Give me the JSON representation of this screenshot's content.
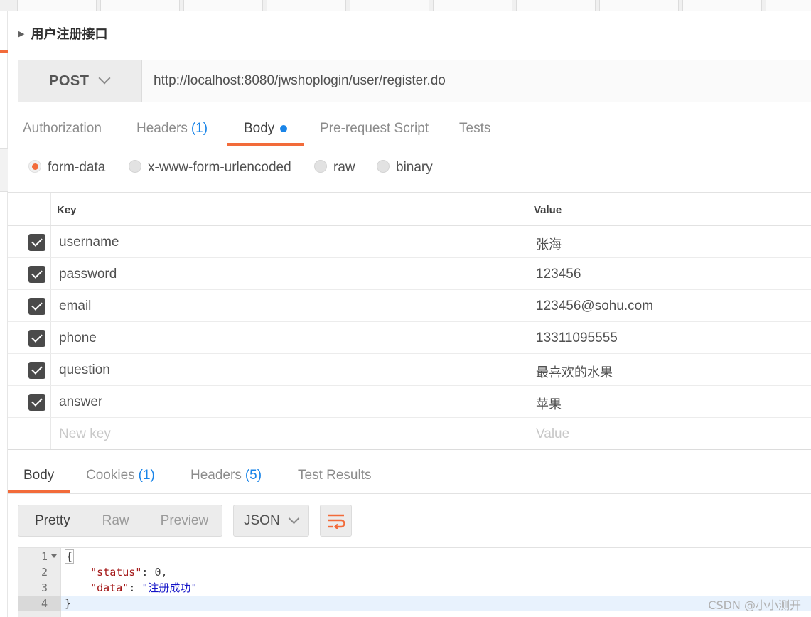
{
  "request": {
    "title": "用户注册接口",
    "method": "POST",
    "url": "http://localhost:8080/jwshoplogin/user/register.do"
  },
  "request_tabs": {
    "authorization": "Authorization",
    "headers": "Headers",
    "headers_count": "(1)",
    "body": "Body",
    "pre_request": "Pre-request Script",
    "tests": "Tests"
  },
  "body_types": {
    "form_data": "form-data",
    "urlencoded": "x-www-form-urlencoded",
    "raw": "raw",
    "binary": "binary",
    "selected": "form-data"
  },
  "params": {
    "key_header": "Key",
    "value_header": "Value",
    "rows": [
      {
        "key": "username",
        "value": "张海",
        "checked": true
      },
      {
        "key": "password",
        "value": "123456",
        "checked": true
      },
      {
        "key": "email",
        "value": "123456@sohu.com",
        "checked": true
      },
      {
        "key": "phone",
        "value": "13311095555",
        "checked": true
      },
      {
        "key": "question",
        "value": "最喜欢的水果",
        "checked": true
      },
      {
        "key": "answer",
        "value": "苹果",
        "checked": true
      }
    ],
    "new_key_placeholder": "New key",
    "new_value_placeholder": "Value"
  },
  "response_tabs": {
    "body": "Body",
    "cookies": "Cookies",
    "cookies_count": "(1)",
    "headers": "Headers",
    "headers_count": "(5)",
    "test_results": "Test Results"
  },
  "response_toolbar": {
    "pretty": "Pretty",
    "raw": "Raw",
    "preview": "Preview",
    "format": "JSON"
  },
  "response_body": {
    "line_numbers": [
      "1",
      "2",
      "3",
      "4"
    ],
    "open_brace": "{",
    "status_key": "\"status\"",
    "status_sep": ": ",
    "status_value": "0",
    "status_comma": ",",
    "data_key": "\"data\"",
    "data_sep": ": ",
    "data_value": "\"注册成功\"",
    "close_brace": "}"
  },
  "watermark": "CSDN @小小测开",
  "colors": {
    "accent": "#f26b3a",
    "link_blue": "#1a85e8"
  }
}
